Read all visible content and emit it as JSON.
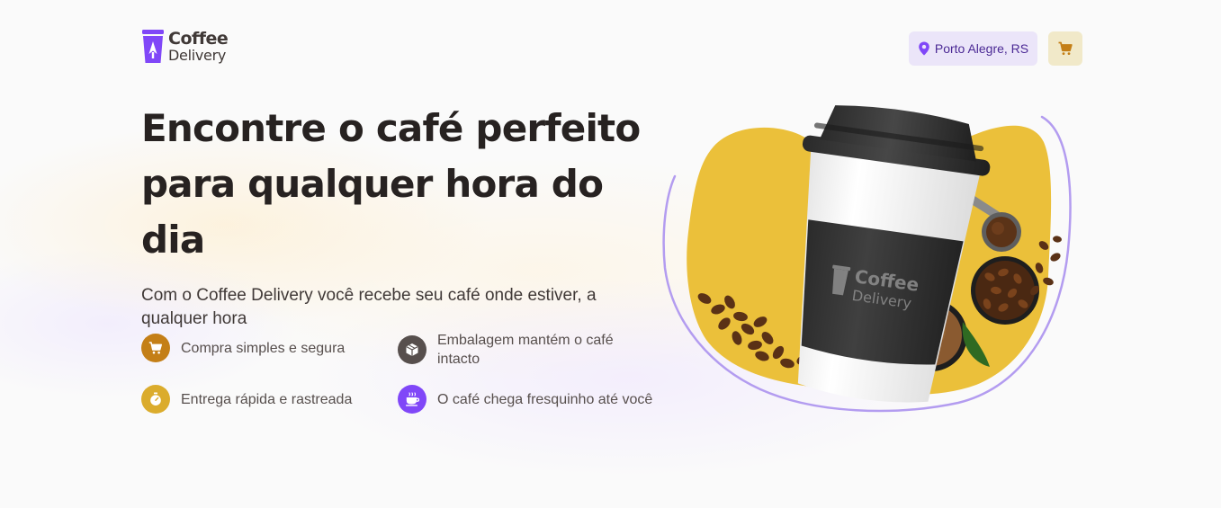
{
  "header": {
    "logo": {
      "line1": "Coffee",
      "line2": "Delivery"
    },
    "location_label": "Porto Alegre, RS",
    "icons": {
      "location": "map-pin-icon",
      "cart": "shopping-cart-icon"
    }
  },
  "hero": {
    "title_line1": "Encontre o café perfeito",
    "title_line2": "para qualquer hora do dia",
    "subtitle": "Com o Coffee Delivery você recebe seu café onde estiver, a qualquer hora",
    "cup_logo": {
      "line1": "Coffee",
      "line2": "Delivery"
    }
  },
  "features": [
    {
      "label": "Compra simples e segura",
      "icon": "shopping-cart-icon",
      "color": "#C47F17"
    },
    {
      "label": "Embalagem mantém o café intacto",
      "icon": "package-icon",
      "color": "#574F4D"
    },
    {
      "label": "Entrega rápida e rastreada",
      "icon": "timer-icon",
      "color": "#DBAC2C"
    },
    {
      "label": "O café chega fresquinho até você",
      "icon": "coffee-icon",
      "color": "#8047F8"
    }
  ],
  "colors": {
    "brand_purple": "#8047F8",
    "purple_light": "#EBE5F9",
    "purple_dark": "#4B2995",
    "yellow": "#DBAC2C",
    "yellow_dark": "#C47F17",
    "yellow_light": "#F1E9C9",
    "title": "#272221",
    "text": "#574F4D"
  }
}
